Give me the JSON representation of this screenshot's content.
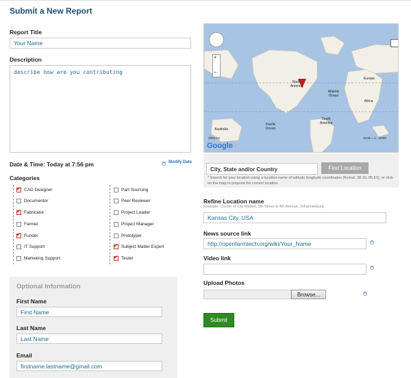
{
  "header": {
    "title": "Submit a New Report"
  },
  "report": {
    "title_label": "Report Title",
    "title_value": "Your Name",
    "description_label": "Description",
    "description_value": "describe how are you contributing",
    "datetime_label": "Date & Time: Today at 7:56 pm",
    "modify_date": "Modify Date"
  },
  "categories": {
    "label": "Categories",
    "left": [
      {
        "label": "CAD Designer",
        "checked": true
      },
      {
        "label": "Documentor",
        "checked": false
      },
      {
        "label": "Fabricator",
        "checked": true
      },
      {
        "label": "Farmer",
        "checked": false
      },
      {
        "label": "Funder",
        "checked": true
      },
      {
        "label": "IT Support",
        "checked": false
      },
      {
        "label": "Marketing Support",
        "checked": false
      }
    ],
    "right": [
      {
        "label": "Part Sourcing",
        "checked": false
      },
      {
        "label": "Peer Reviewer",
        "checked": false
      },
      {
        "label": "Project Leader",
        "checked": false
      },
      {
        "label": "Project Manager",
        "checked": false
      },
      {
        "label": "Prototyper",
        "checked": false
      },
      {
        "label": "Subject Matter Expert",
        "checked": true
      },
      {
        "label": "Tester",
        "checked": true
      }
    ]
  },
  "optional": {
    "heading": "Optional Information",
    "first_label": "First Name",
    "first_value": "First Name",
    "last_label": "Last Name",
    "last_value": "Last Name",
    "email_label": "Email",
    "email_value": "firstname.lastname@gmail.com"
  },
  "map": {
    "labels": [
      "North America",
      "Atlantic Ocean",
      "Europe",
      "Africa",
      "South America",
      "Australia",
      "Pacific Ocean"
    ],
    "scale_left": "2000 km",
    "scale_right": "Scale = 1 : 200M",
    "logo": "Google"
  },
  "location": {
    "search_placeholder": "City, State and/or Country",
    "find_button": "Find Location",
    "help": "* Search for your location using a location name of latitude,longitude coordinates (format: 38.19,-85.61), or click on the map to pinpoint the correct location.",
    "refine_label": "Refine Location name",
    "refine_example": "Example: Corner of City Market, 5th Street & 4th Avenue, Johannesburg",
    "refine_value": "Kansas City, USA"
  },
  "media": {
    "news_label": "News source link",
    "news_value": "http://openfarmtech.org/wiki/Your_Name",
    "video_label": "Video link",
    "video_value": "",
    "photos_label": "Upload Photos",
    "browse": "Browse...",
    "submit": "Submit"
  }
}
